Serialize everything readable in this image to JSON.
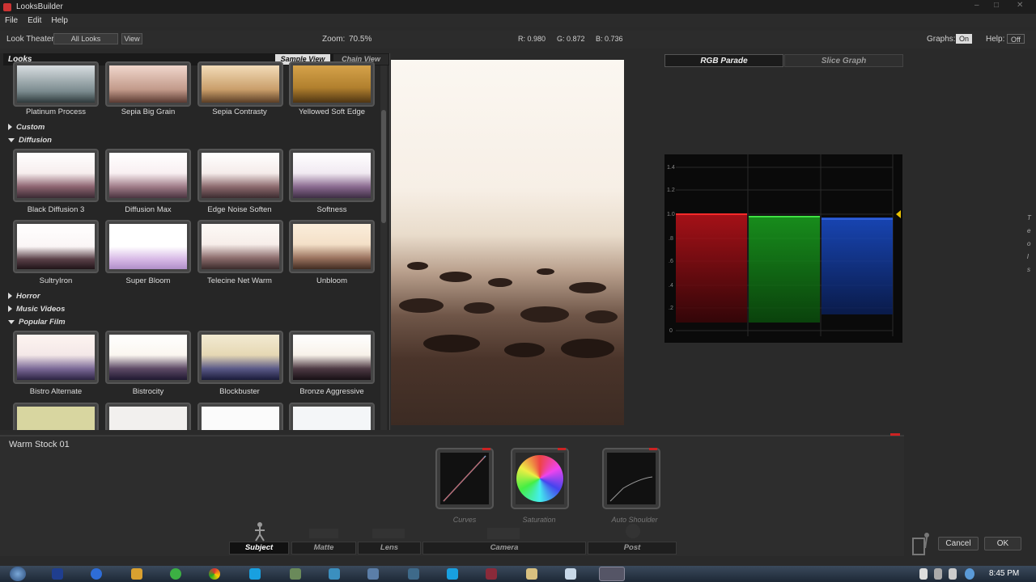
{
  "window": {
    "title": "LooksBuilder",
    "controls": [
      "–",
      "□",
      "✕"
    ]
  },
  "menu": [
    "File",
    "Edit",
    "Help"
  ],
  "toolbar": {
    "look_theater_label": "Look Theater:",
    "look_theater_value": "All Looks",
    "view_button": "View",
    "zoom_label": "Zoom:",
    "zoom_value": "70.5%",
    "r": "R: 0.980",
    "g": "G: 0.872",
    "b": "B: 0.736",
    "graphs_label": "Graphs:",
    "graphs_value": "On",
    "help_label": "Help:",
    "help_value": "Off"
  },
  "looks": {
    "header": "Looks",
    "tab_sample": "Sample View",
    "tab_chain": "Chain View",
    "row1": [
      "Platinum Process",
      "Sepia Big Grain",
      "Sepia Contrasty",
      "Yellowed Soft Edge"
    ],
    "categories": {
      "custom": "Custom",
      "diffusion": "Diffusion",
      "horror": "Horror",
      "music_videos": "Music Videos",
      "popular_film": "Popular Film"
    },
    "diffusion_row1": [
      "Black Diffusion 3",
      "Diffusion Max",
      "Edge Noise Soften",
      "Softness"
    ],
    "diffusion_row2": [
      "SultryIron",
      "Super Bloom",
      "Telecine Net Warm",
      "Unbloom"
    ],
    "popular_row1": [
      "Bistro Alternate",
      "Bistrocity",
      "Blockbuster",
      "Bronze Aggressive"
    ]
  },
  "graphs": {
    "tab_parade": "RGB Parade",
    "tab_slice": "Slice Graph",
    "y_ticks": [
      "1.4",
      "1.2",
      "1.0",
      ".8",
      ".6",
      ".4",
      ".2",
      "0"
    ],
    "colors": {
      "red": "#c0121a",
      "green": "#1aa31f",
      "blue": "#1a4fd0"
    }
  },
  "bottom": {
    "look_name": "Warm Stock 01",
    "nodes": [
      "Curves",
      "Saturation",
      "Auto Shoulder"
    ],
    "stages": [
      "Subject",
      "Matte",
      "Lens",
      "Camera",
      "Post"
    ],
    "cancel": "Cancel",
    "ok": "OK"
  },
  "side_letters": [
    "T",
    "e",
    "o",
    "l",
    "s"
  ],
  "taskbar": {
    "time": "8:45 PM"
  }
}
